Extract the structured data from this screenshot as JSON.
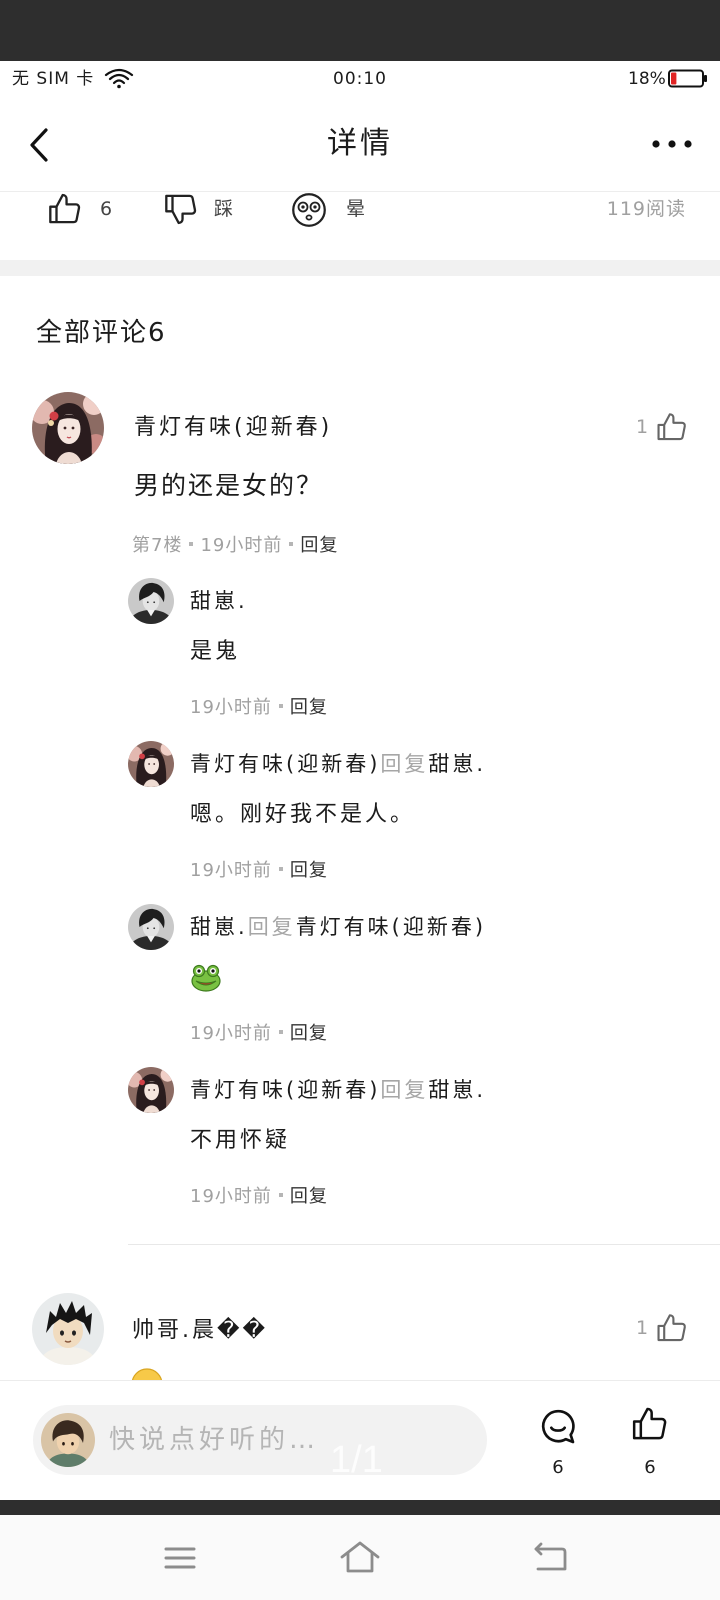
{
  "status_bar": {
    "carrier": "无 SIM 卡",
    "wifi_icon": "wifi-icon",
    "time": "00:10",
    "battery_text": "18%",
    "battery_level": 0.18,
    "battery_fill_color": "#e02424"
  },
  "header": {
    "back_icon": "chevron-left-icon",
    "title": "详情",
    "more_icon": "more-dots-icon"
  },
  "reactions": {
    "like_icon": "thumbs-up-icon",
    "like_count": "6",
    "dislike_icon": "thumbs-down-icon",
    "dislike_label": "踩",
    "dizzy_icon": "dizzy-face-icon",
    "dizzy_label": "晕",
    "read_count": "119阅读"
  },
  "comments_section": {
    "title": "全部评论6"
  },
  "comments": [
    {
      "author": "青灯有味(迎新春)",
      "like_count": "1",
      "text": "男的还是女的？",
      "floor": "第7楼",
      "time": "19小时前",
      "reply_action": "回复",
      "replies": [
        {
          "author": "甜崽.",
          "text": "是鬼",
          "time": "19小时前",
          "reply_action": "回复"
        },
        {
          "author": "青灯有味(迎新春)",
          "reply_word": "回复",
          "reply_to": "甜崽.",
          "text": "嗯。刚好我不是人。",
          "time": "19小时前",
          "reply_action": "回复"
        },
        {
          "author": "甜崽.",
          "reply_word": "回复",
          "reply_to": "青灯有味(迎新春)",
          "emoji": "frog-emoji",
          "time": "19小时前",
          "reply_action": "回复"
        },
        {
          "author": "青灯有味(迎新春)",
          "reply_word": "回复",
          "reply_to": "甜崽.",
          "text": "不用怀疑",
          "time": "19小时前",
          "reply_action": "回复"
        }
      ]
    },
    {
      "author": "帅哥.晨��",
      "like_count": "1"
    }
  ],
  "composer": {
    "placeholder": "快说点好听的…",
    "page_indicator": "1/1",
    "comment_icon": "comment-bubble-icon",
    "comment_count": "6",
    "like_icon": "thumbs-up-icon",
    "like_count": "6"
  },
  "nav_bar": {
    "menu_icon": "menu-icon",
    "home_icon": "home-icon",
    "back_icon": "back-icon"
  },
  "colors": {
    "text": "#1c1c1c",
    "secondary_text": "#a0a0a0",
    "input_bg": "#f2f2f2",
    "system_bar": "#2e2e2e"
  }
}
